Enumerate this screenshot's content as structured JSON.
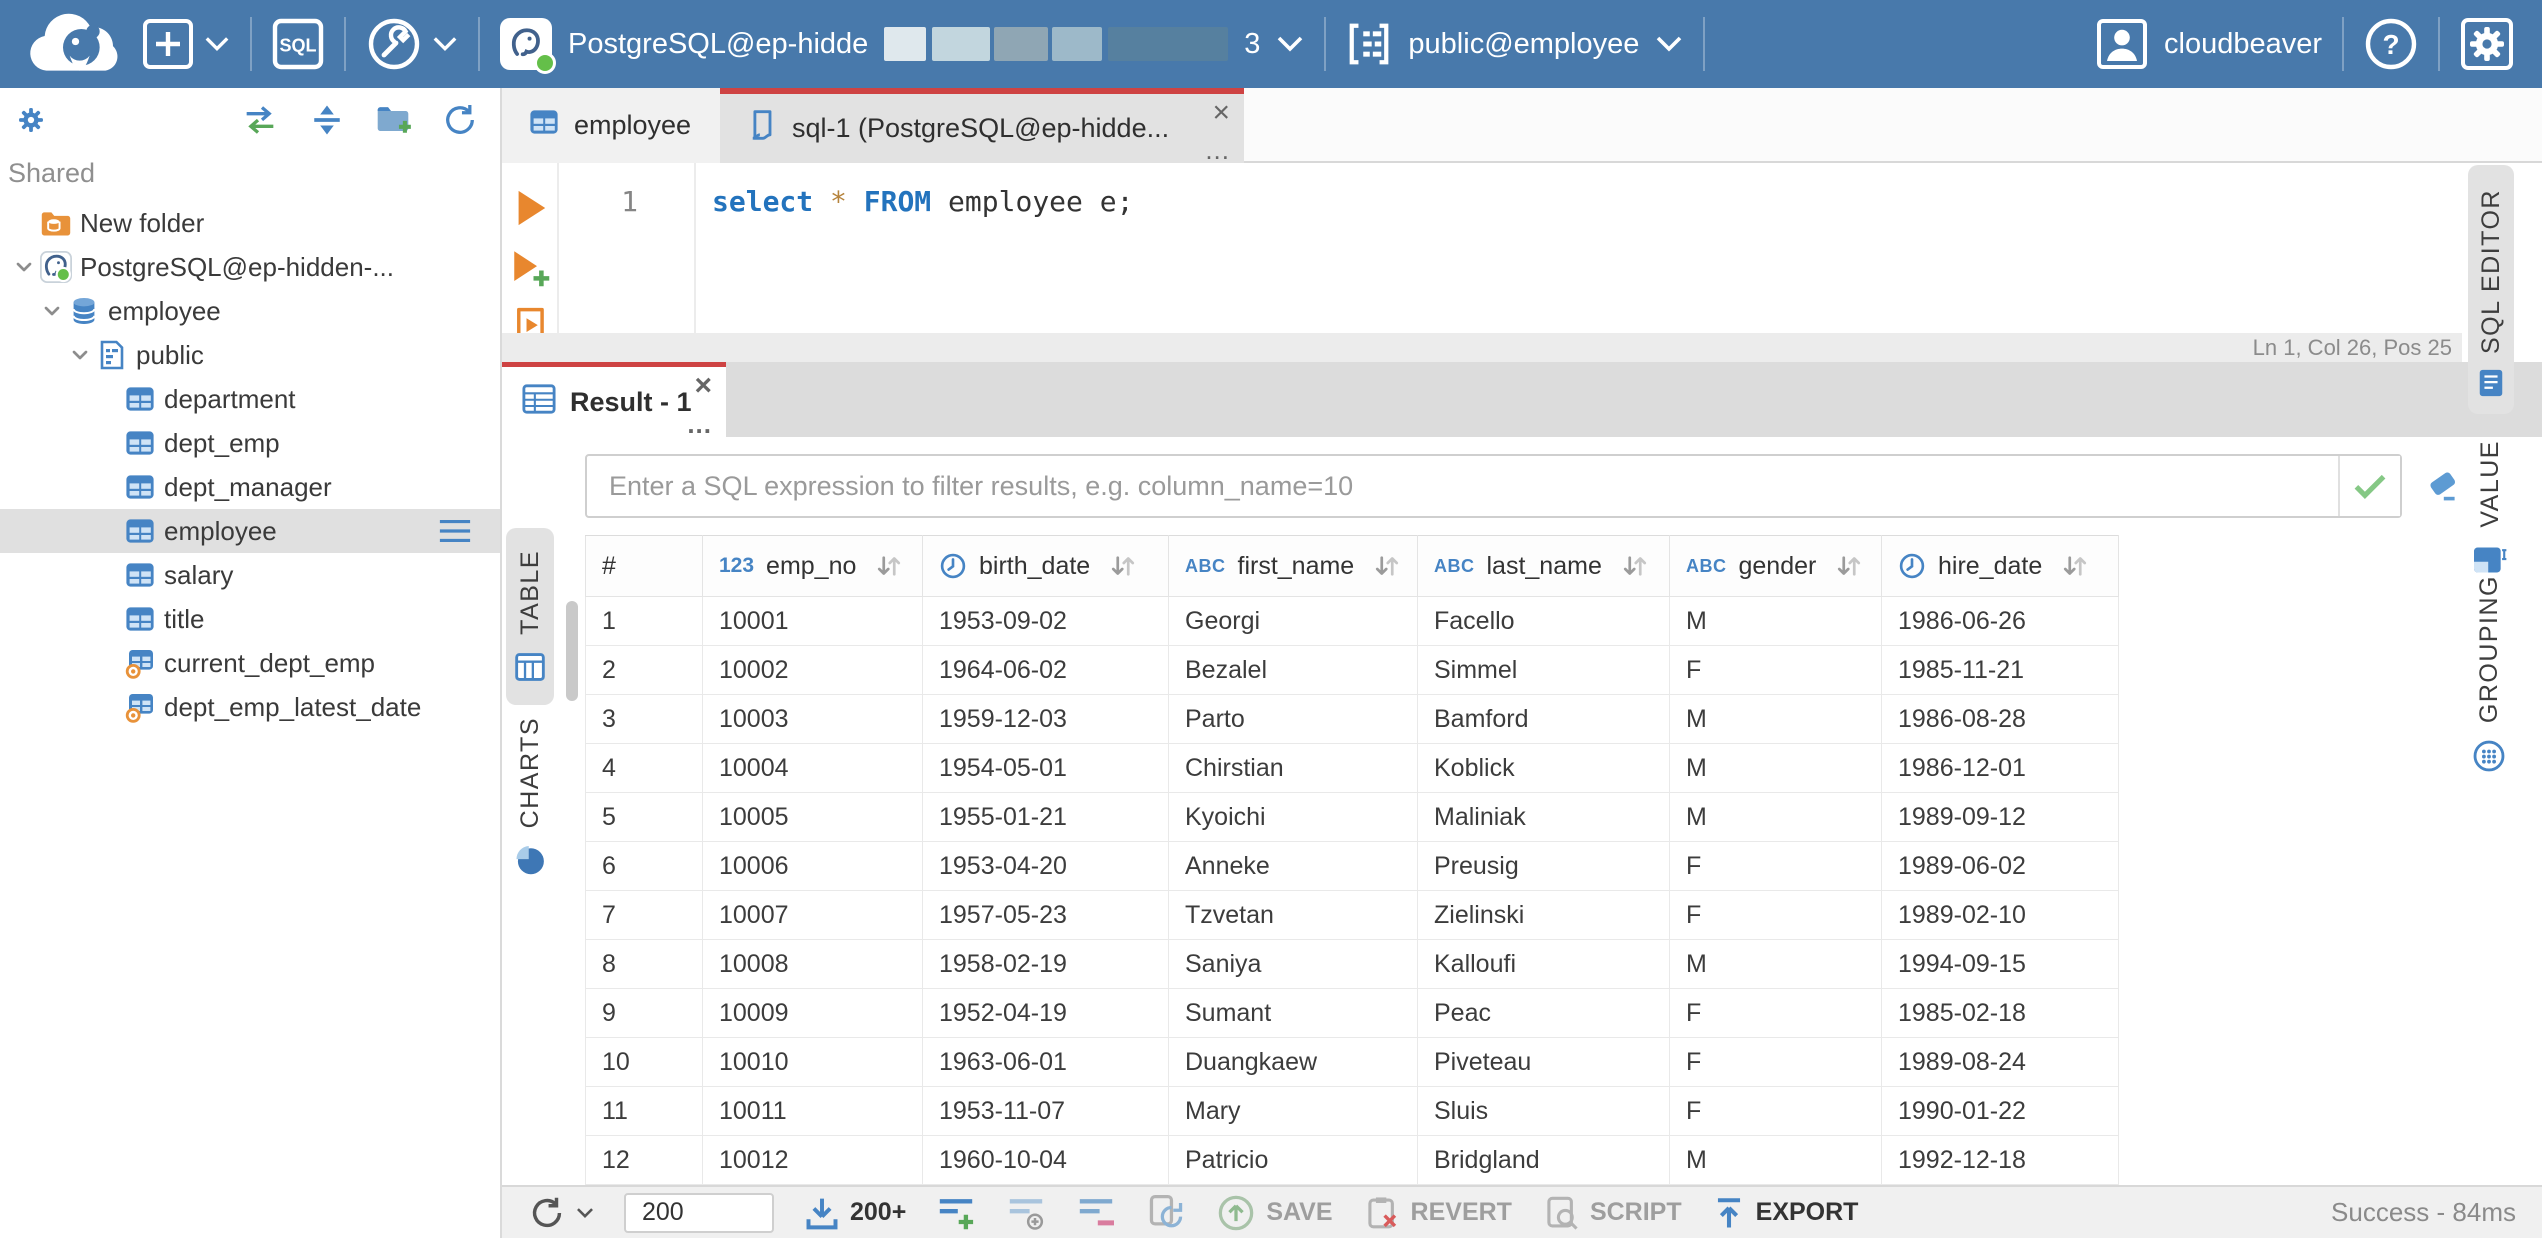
{
  "colors": {
    "topbar": "#4879ab",
    "accent_red": "#ce4343",
    "icon_blue": "#4684c4",
    "icon_orange": "#e8923a",
    "ok_green": "#64bf49"
  },
  "topbar": {
    "sql_button_label": "SQL",
    "connection_label": "PostgreSQL@ep-hidde",
    "connection_suffix": "3",
    "schema_label": "public@employee",
    "user_label": "cloudbeaver",
    "help_glyph": "?"
  },
  "sidebar": {
    "section_label": "Shared",
    "tree": [
      {
        "label": "New folder",
        "icon": "folderdb",
        "level": 0,
        "expandable": false,
        "selected": false
      },
      {
        "label": "PostgreSQL@ep-hidden-...",
        "icon": "pg",
        "level": 0,
        "expandable": true,
        "selected": false
      },
      {
        "label": "employee",
        "icon": "db",
        "level": 1,
        "expandable": true,
        "selected": false
      },
      {
        "label": "public",
        "icon": "schema",
        "level": 2,
        "expandable": true,
        "selected": false
      },
      {
        "label": "department",
        "icon": "table",
        "level": 3,
        "expandable": false,
        "selected": false
      },
      {
        "label": "dept_emp",
        "icon": "table",
        "level": 3,
        "expandable": false,
        "selected": false
      },
      {
        "label": "dept_manager",
        "icon": "table",
        "level": 3,
        "expandable": false,
        "selected": false
      },
      {
        "label": "employee",
        "icon": "table",
        "level": 3,
        "expandable": false,
        "selected": true
      },
      {
        "label": "salary",
        "icon": "table",
        "level": 3,
        "expandable": false,
        "selected": false
      },
      {
        "label": "title",
        "icon": "table",
        "level": 3,
        "expandable": false,
        "selected": false
      },
      {
        "label": "current_dept_emp",
        "icon": "view",
        "level": 3,
        "expandable": false,
        "selected": false
      },
      {
        "label": "dept_emp_latest_date",
        "icon": "view",
        "level": 3,
        "expandable": false,
        "selected": false
      }
    ]
  },
  "editor": {
    "tab_employee": "employee",
    "tab_sql": "sql-1 (PostgreSQL@ep-hidde...",
    "close_glyph": "×",
    "more_glyph": "...",
    "line_number": "1",
    "tokens": {
      "kw1": "select",
      "star": "*",
      "kw2": "FROM",
      "rest": "employee e;"
    },
    "status_line": "Ln 1, Col 26, Pos 25",
    "side_tab": "SQL EDITOR"
  },
  "result": {
    "tab_label": "Result - 1",
    "close_glyph": "×",
    "more_glyph": "...",
    "filter_placeholder": "Enter a SQL expression to filter results, e.g. column_name=10",
    "table_tab": "TABLE",
    "charts_tab": "CHARTS",
    "value_tab": "VALUE",
    "grouping_tab": "GROUPING"
  },
  "grid": {
    "type_badges": {
      "number": "123",
      "string": "ABC"
    },
    "columns": [
      {
        "name": "#",
        "type": null,
        "sortable": false
      },
      {
        "name": "emp_no",
        "type": "number",
        "sortable": true
      },
      {
        "name": "birth_date",
        "type": "datetime",
        "sortable": true
      },
      {
        "name": "first_name",
        "type": "string",
        "sortable": true
      },
      {
        "name": "last_name",
        "type": "string",
        "sortable": true
      },
      {
        "name": "gender",
        "type": "string",
        "sortable": true
      },
      {
        "name": "hire_date",
        "type": "datetime",
        "sortable": true
      }
    ],
    "rows": [
      [
        "1",
        "10001",
        "1953-09-02",
        "Georgi",
        "Facello",
        "M",
        "1986-06-26"
      ],
      [
        "2",
        "10002",
        "1964-06-02",
        "Bezalel",
        "Simmel",
        "F",
        "1985-11-21"
      ],
      [
        "3",
        "10003",
        "1959-12-03",
        "Parto",
        "Bamford",
        "M",
        "1986-08-28"
      ],
      [
        "4",
        "10004",
        "1954-05-01",
        "Chirstian",
        "Koblick",
        "M",
        "1986-12-01"
      ],
      [
        "5",
        "10005",
        "1955-01-21",
        "Kyoichi",
        "Maliniak",
        "M",
        "1989-09-12"
      ],
      [
        "6",
        "10006",
        "1953-04-20",
        "Anneke",
        "Preusig",
        "F",
        "1989-06-02"
      ],
      [
        "7",
        "10007",
        "1957-05-23",
        "Tzvetan",
        "Zielinski",
        "F",
        "1989-02-10"
      ],
      [
        "8",
        "10008",
        "1958-02-19",
        "Saniya",
        "Kalloufi",
        "M",
        "1994-09-15"
      ],
      [
        "9",
        "10009",
        "1952-04-19",
        "Sumant",
        "Peac",
        "F",
        "1985-02-18"
      ],
      [
        "10",
        "10010",
        "1963-06-01",
        "Duangkaew",
        "Piveteau",
        "F",
        "1989-08-24"
      ],
      [
        "11",
        "10011",
        "1953-11-07",
        "Mary",
        "Sluis",
        "F",
        "1990-01-22"
      ],
      [
        "12",
        "10012",
        "1960-10-04",
        "Patricio",
        "Bridgland",
        "M",
        "1992-12-18"
      ]
    ]
  },
  "toolbar": {
    "rows_input": "200",
    "fetch_more_label": "200+",
    "save_label": "SAVE",
    "revert_label": "REVERT",
    "script_label": "SCRIPT",
    "export_label": "EXPORT",
    "status": "Success - 84ms"
  }
}
